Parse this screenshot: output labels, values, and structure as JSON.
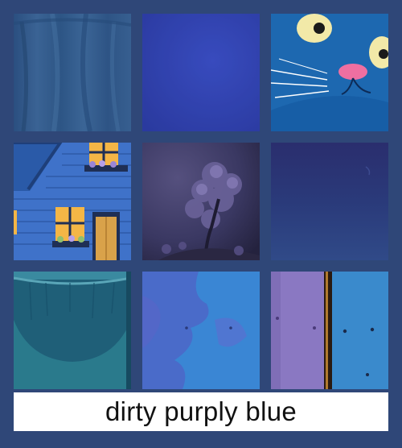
{
  "caption": "dirty purply blue",
  "colors": {
    "background": "#2f4778",
    "caption_background": "#ffffff",
    "caption_text": "#111111"
  },
  "tiles": [
    {
      "name": "fabric-drape",
      "dominant_color": "#31588a"
    },
    {
      "name": "textured-blue-canvas",
      "dominant_color": "#3245b3"
    },
    {
      "name": "cartoon-blue-cat",
      "dominant_color": "#1f6fb8"
    },
    {
      "name": "blue-house-window",
      "dominant_color": "#3c70c8"
    },
    {
      "name": "misty-purple-tree",
      "dominant_color": "#3b3a63"
    },
    {
      "name": "dark-navy-texture",
      "dominant_color": "#2a3a78"
    },
    {
      "name": "teal-ceramic-bowl",
      "dominant_color": "#1d5b72"
    },
    {
      "name": "worn-blue-wall",
      "dominant_color": "#3f72c7"
    },
    {
      "name": "purple-blue-planks",
      "dominant_color": "#3a82c4"
    }
  ]
}
